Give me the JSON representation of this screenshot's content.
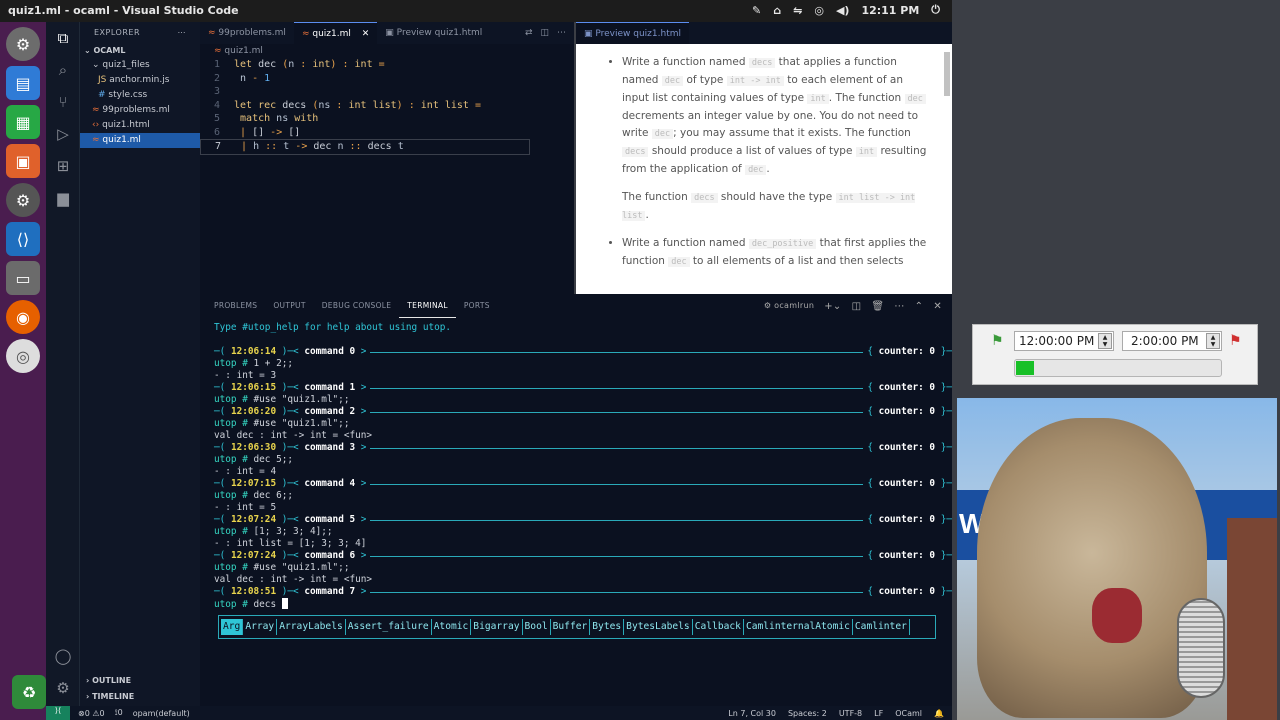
{
  "window": {
    "title": "quiz1.ml - ocaml - Visual Studio Code",
    "time": "12:11 PM"
  },
  "explorer": {
    "header": "EXPLORER",
    "root": "OCAML",
    "items": [
      {
        "label": "quiz1_files",
        "indent": 1,
        "icon": "chevron-down"
      },
      {
        "label": "anchor.min.js",
        "indent": 2,
        "icon": "JS"
      },
      {
        "label": "style.css",
        "indent": 2,
        "icon": "#"
      },
      {
        "label": "99problems.ml",
        "indent": 1,
        "icon": "ml"
      },
      {
        "label": "quiz1.html",
        "indent": 1,
        "icon": "<>"
      },
      {
        "label": "quiz1.ml",
        "indent": 1,
        "icon": "ml",
        "selected": true
      }
    ],
    "outline": "OUTLINE",
    "timeline": "TIMELINE"
  },
  "editor": {
    "tabs": [
      "99problems.ml",
      "quiz1.ml",
      "Preview quiz1.html"
    ],
    "breadcrumb": "quiz1.ml",
    "lines": [
      {
        "n": "1",
        "text": "let dec (n : int) : int ="
      },
      {
        "n": "2",
        "text": "  n - 1"
      },
      {
        "n": "3",
        "text": ""
      },
      {
        "n": "4",
        "text": "let rec decs (ns : int list) : int list ="
      },
      {
        "n": "5",
        "text": "  match ns with"
      },
      {
        "n": "6",
        "text": "  | [] -> []"
      },
      {
        "n": "7",
        "text": "  | h :: t -> dec n :: decs t"
      }
    ]
  },
  "preview": {
    "tab": "Preview quiz1.html",
    "p1": [
      "Write a function named ",
      "decs",
      " that applies a function named ",
      "dec",
      " of type ",
      "int -> int",
      " to each element of an input list containing values of type ",
      "int",
      ". The function ",
      "dec",
      " decrements an integer value by one. You do not need to write ",
      "dec",
      "; you may assume that it exists. The function ",
      "decs",
      " should produce a list of values of type ",
      "int",
      " resulting from the application of ",
      "dec",
      "."
    ],
    "p2": [
      "The function ",
      "decs",
      " should have the type ",
      "int list -> int list",
      "."
    ],
    "p3": [
      "Write a function named ",
      "dec_positive",
      " that first applies the function ",
      "dec",
      " to all elements of a list and then selects"
    ]
  },
  "panel": {
    "tabs": [
      "PROBLEMS",
      "OUTPUT",
      "DEBUG CONSOLE",
      "TERMINAL",
      "PORTS"
    ],
    "active": "TERMINAL",
    "shell": "ocamlrun",
    "help": "Type #utop_help for help about using utop.",
    "blocks": [
      {
        "time": "12:06:14",
        "cmd": "command 0",
        "counter": "counter: 0",
        "lines": [
          {
            "p": "utop # ",
            "t": "1 + 2;;"
          },
          {
            "t": "- : int = 3"
          }
        ]
      },
      {
        "time": "12:06:15",
        "cmd": "command 1",
        "counter": "counter: 0",
        "lines": [
          {
            "p": "utop # ",
            "t": "#use \"quiz1.ml\";;"
          }
        ]
      },
      {
        "time": "12:06:20",
        "cmd": "command 2",
        "counter": "counter: 0",
        "lines": [
          {
            "p": "utop # ",
            "t": "#use \"quiz1.ml\";;"
          },
          {
            "t": "val dec : int -> int = <fun>"
          }
        ]
      },
      {
        "time": "12:06:30",
        "cmd": "command 3",
        "counter": "counter: 0",
        "lines": [
          {
            "p": "utop # ",
            "t": "dec 5;;"
          },
          {
            "t": "- : int = 4"
          }
        ]
      },
      {
        "time": "12:07:15",
        "cmd": "command 4",
        "counter": "counter: 0",
        "lines": [
          {
            "p": "utop # ",
            "t": "dec 6;;"
          },
          {
            "t": "- : int = 5"
          }
        ]
      },
      {
        "time": "12:07:24",
        "cmd": "command 5",
        "counter": "counter: 0",
        "lines": [
          {
            "p": "utop # ",
            "t": "[1; 3; 3; 4];;"
          },
          {
            "t": "- : int list = [1; 3; 3; 4]"
          }
        ]
      },
      {
        "time": "12:07:24",
        "cmd": "command 6",
        "counter": "counter: 0",
        "lines": [
          {
            "p": "utop # ",
            "t": "#use \"quiz1.ml\";;"
          },
          {
            "t": "val dec : int -> int = <fun>"
          }
        ]
      },
      {
        "time": "12:08:51",
        "cmd": "command 7",
        "counter": "counter: 0",
        "lines": [
          {
            "p": "utop # ",
            "t": "decs",
            "cursor": true
          }
        ]
      }
    ],
    "modules": [
      "Arg",
      "Array",
      "ArrayLabels",
      "Assert_failure",
      "Atomic",
      "Bigarray",
      "Bool",
      "Buffer",
      "Bytes",
      "BytesLabels",
      "Callback",
      "CamlinternalAtomic",
      "Camlinter"
    ]
  },
  "status": {
    "left": [
      "⊗0 ⚠0",
      "⟟0",
      "opam(default)"
    ],
    "right": [
      "Ln 7, Col 30",
      "Spaces: 2",
      "UTF-8",
      "LF",
      "OCaml"
    ]
  },
  "timer": {
    "start": "12:00:00 PM",
    "end": "2:00:00 PM",
    "progress": 0.09,
    "progress_color": "#18c027"
  },
  "webcam": {
    "sign": "Wal"
  }
}
